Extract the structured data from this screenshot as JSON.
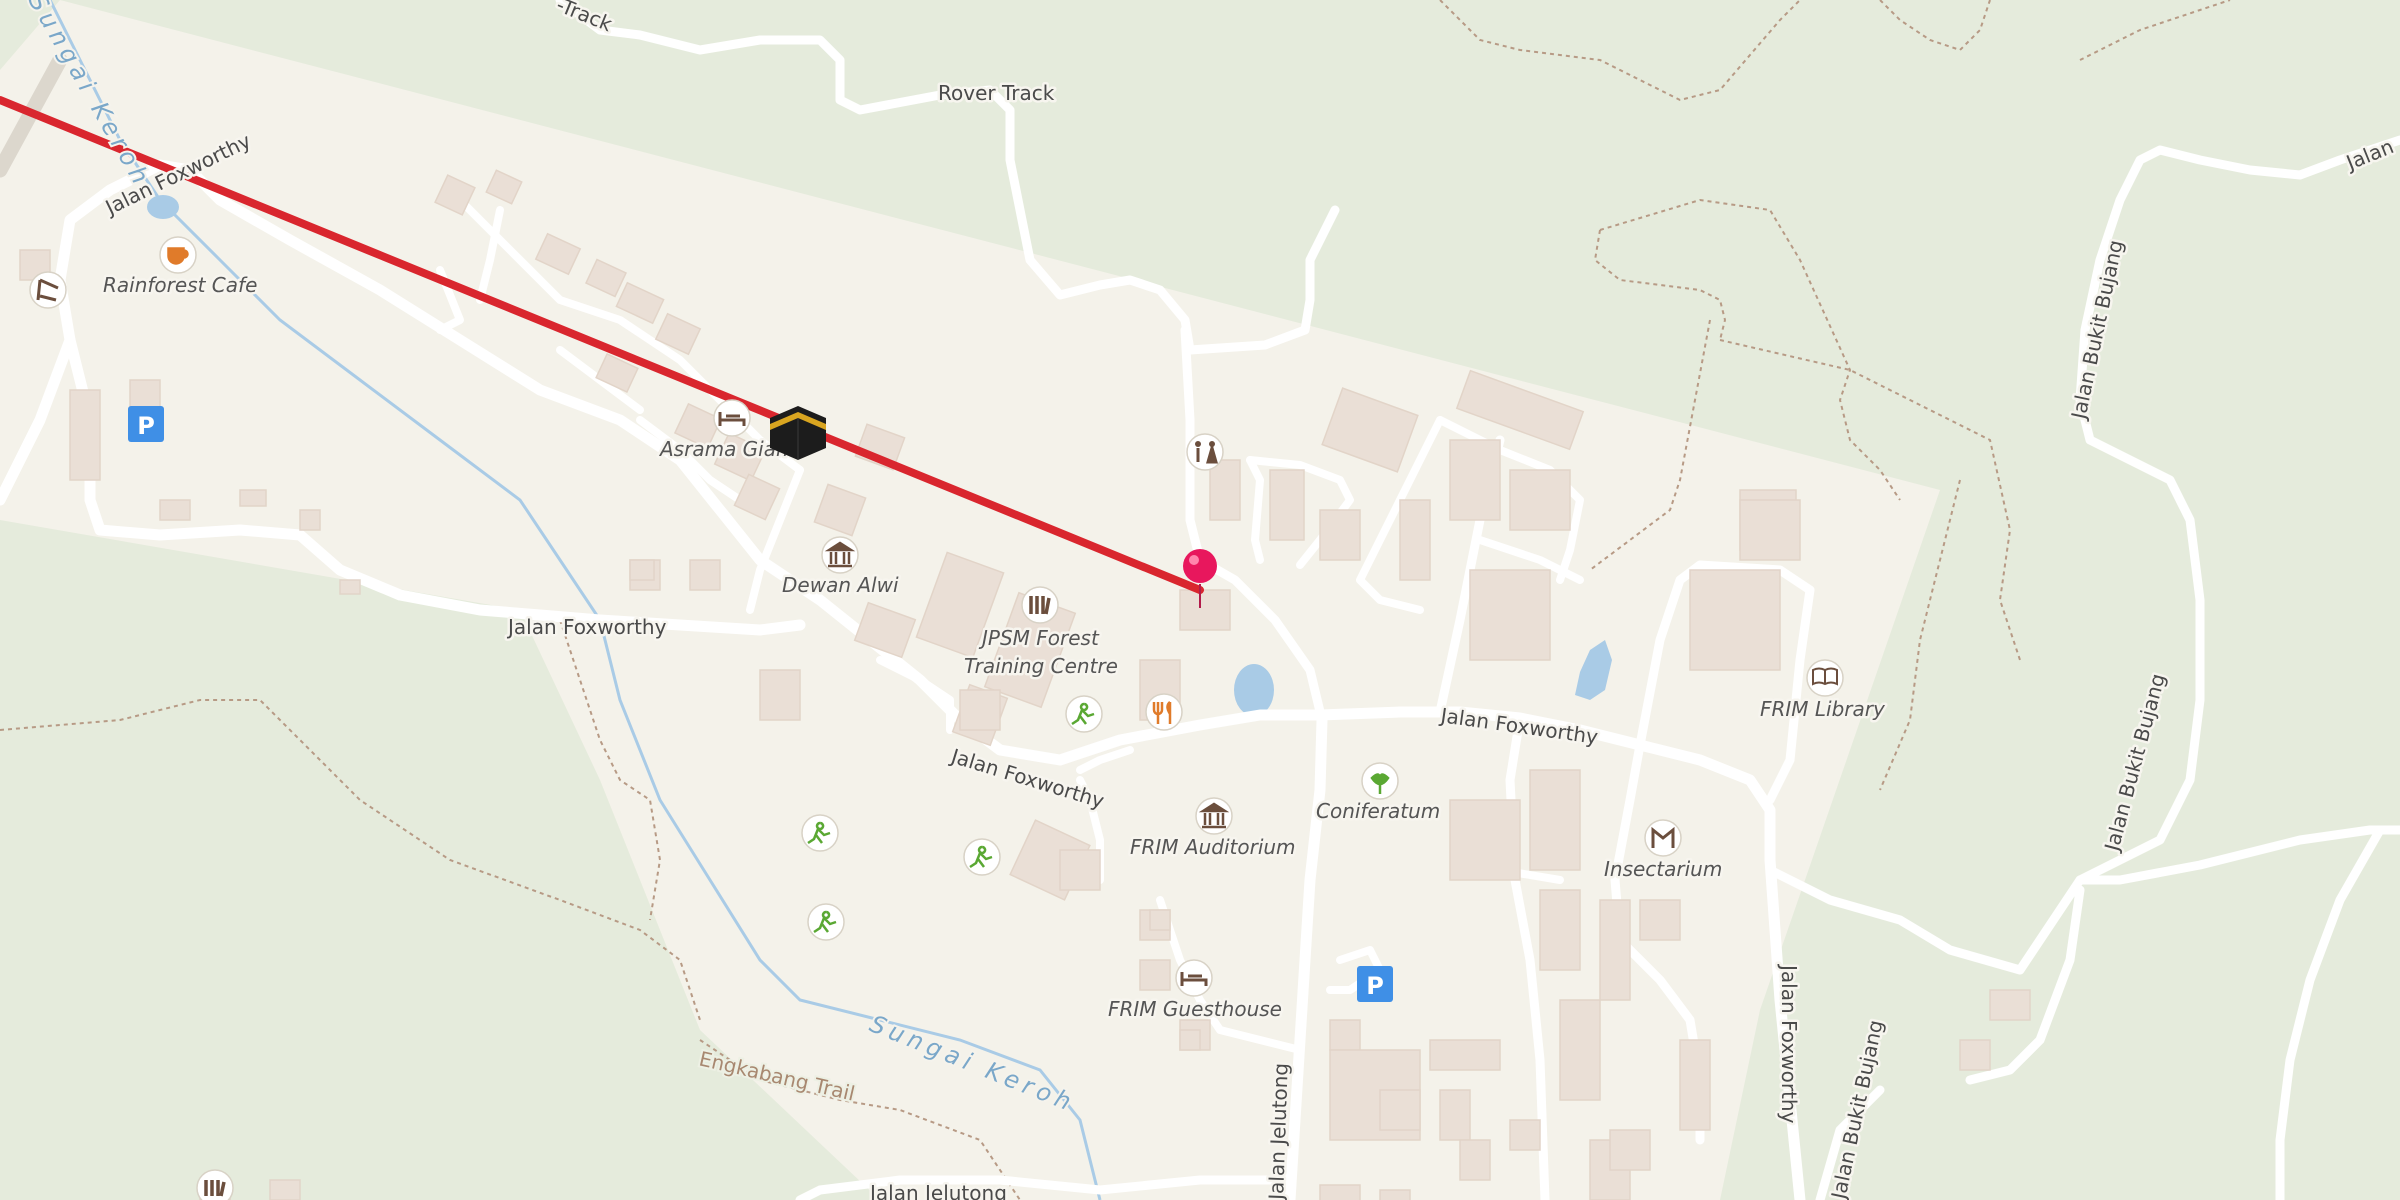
{
  "map": {
    "colors": {
      "forest": "#e5ebdc",
      "campus": "#f4f2ea",
      "road": "#ffffff",
      "water": "#a9cbe6",
      "building": "#eadfd6",
      "route": "#d9262e",
      "marker": "#e8175d",
      "parking": "#3f8fe6"
    },
    "roads": {
      "jalan_foxworthy_nw": "Jalan Foxworthy",
      "jalan_foxworthy_west": "Jalan Foxworthy",
      "jalan_foxworthy_central": "Jalan Foxworthy",
      "jalan_foxworthy_east": "Jalan Foxworthy",
      "jalan_foxworthy_south": "Jalan Foxworthy",
      "jalan_jelutong_south": "Jalan Jelutong",
      "jalan_jelutong_bottom": "Jalan Jelutong",
      "jalan_bukit_bujang_a": "Jalan Bukit Bujang",
      "jalan_bukit_bujang_b": "Jalan Bukit Bujang",
      "jalan_bukit_bujang_c": "Jalan Bukit Bujang",
      "jalan_bukit_bujang_partial": "Jalan",
      "rover_track": "Rover Track",
      "track_partial": "-Track"
    },
    "water": {
      "sungai_keroh_main": "Sungai Keroh",
      "sungai_keroh_north": "Sungai Keroh"
    },
    "trails": {
      "engkabang": "Engkabang Trail"
    },
    "pois": {
      "rainforest_cafe": "Rainforest Cafe",
      "asrama_giam": "Asrama Giam",
      "dewan_alwi": "Dewan Alwi",
      "jpsm_line1": "JPSM Forest",
      "jpsm_line2": "Training Centre",
      "frim_library": "FRIM Library",
      "coniferatum": "Coniferatum",
      "frim_auditorium": "FRIM Auditorium",
      "insectarium": "Insectarium",
      "frim_guesthouse": "FRIM Guesthouse"
    },
    "parking_label": "P",
    "icons": [
      "cafe-icon",
      "shelter-icon",
      "parking-icon",
      "hotel-icon",
      "mosque-icon",
      "toilets-icon",
      "museum-icon",
      "library-icon",
      "restaurant-icon",
      "sport-icon",
      "garden-icon",
      "location-pin-icon",
      "book-icon"
    ]
  }
}
